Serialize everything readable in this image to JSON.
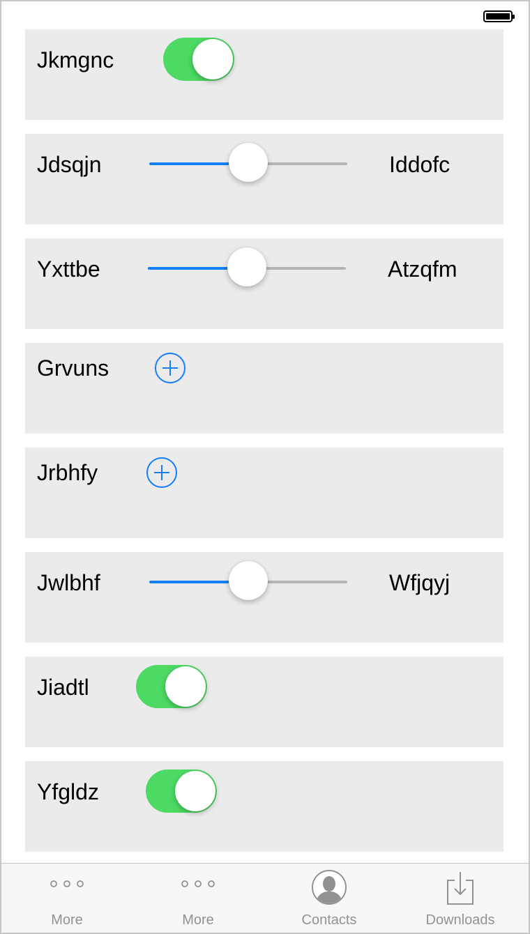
{
  "status_bar": {
    "battery_icon": "battery-full-icon"
  },
  "rows": [
    {
      "type": "toggle",
      "label": "Jkmgnc",
      "on": true
    },
    {
      "type": "slider",
      "label": "Jdsqjn",
      "right_label": "Iddofc",
      "value": 0.5
    },
    {
      "type": "slider",
      "label": "Yxttbe",
      "right_label": "Atzqfm",
      "value": 0.5
    },
    {
      "type": "add",
      "label": "Grvuns",
      "icon": "add-circle-icon"
    },
    {
      "type": "add",
      "label": "Jrbhfy",
      "icon": "add-circle-icon"
    },
    {
      "type": "slider",
      "label": "Jwlbhf",
      "right_label": "Wfjqyj",
      "value": 0.5
    },
    {
      "type": "toggle",
      "label": "Jiadtl",
      "on": true
    },
    {
      "type": "toggle",
      "label": "Yfgldz",
      "on": true
    }
  ],
  "tabbar": {
    "tabs": [
      {
        "label": "More",
        "icon": "more-dots-icon"
      },
      {
        "label": "More",
        "icon": "more-dots-icon"
      },
      {
        "label": "Contacts",
        "icon": "contacts-icon"
      },
      {
        "label": "Downloads",
        "icon": "downloads-icon"
      }
    ]
  },
  "colors": {
    "toggle_on": "#4cd964",
    "accent": "#147efb",
    "row_background": "#ebebeb",
    "tab_inactive": "#929292"
  }
}
